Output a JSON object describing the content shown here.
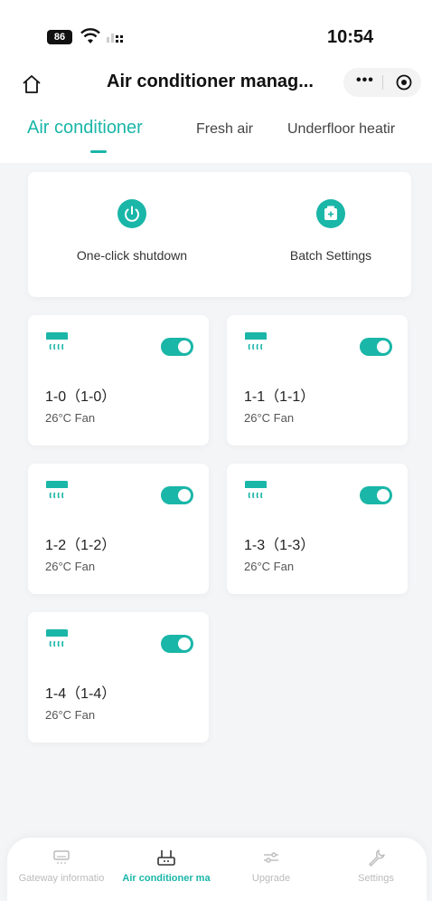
{
  "status_bar": {
    "battery": "86",
    "time": "10:54"
  },
  "nav": {
    "title": "Air conditioner manag..."
  },
  "tabs": [
    {
      "label": "Air conditioner"
    },
    {
      "label": "Fresh air"
    },
    {
      "label": "Underfloor heatir"
    }
  ],
  "quick_actions": [
    {
      "label": "One-click shutdown",
      "icon": "power-icon"
    },
    {
      "label": "Batch Settings",
      "icon": "batch-settings-icon"
    }
  ],
  "devices": [
    {
      "name": "1-0（1-0）",
      "status": "26°C  Fan",
      "on": true
    },
    {
      "name": "1-1（1-1）",
      "status": "26°C  Fan",
      "on": true
    },
    {
      "name": "1-2（1-2）",
      "status": "26°C  Fan",
      "on": true
    },
    {
      "name": "1-3（1-3）",
      "status": "26°C  Fan",
      "on": true
    },
    {
      "name": "1-4（1-4）",
      "status": "26°C  Fan",
      "on": true
    }
  ],
  "bottom_tabs": [
    {
      "label": "Gateway informatio",
      "icon": "gateway-icon"
    },
    {
      "label": "Air conditioner ma",
      "icon": "router-icon"
    },
    {
      "label": "Upgrade",
      "icon": "sliders-icon"
    },
    {
      "label": "Settings",
      "icon": "wrench-icon"
    }
  ],
  "colors": {
    "accent": "#1ab6a8",
    "background": "#f4f5f7",
    "inactive": "#bbbbbb"
  }
}
